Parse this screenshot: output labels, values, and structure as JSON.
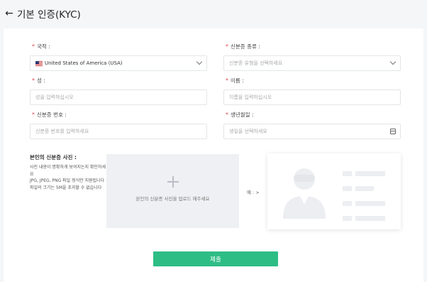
{
  "header": {
    "back_icon": "arrow-left-icon",
    "title": "기본 인증(KYC)"
  },
  "form": {
    "nationality": {
      "label": "국적 :",
      "value": "United States of America (USA)",
      "flag_icon": "us-flag-icon"
    },
    "id_type": {
      "label": "신분증 종류 :",
      "placeholder": "신분증 유형을 선택하세요"
    },
    "last_name": {
      "label": "성 :",
      "placeholder": "성을 입력하십시오"
    },
    "first_name": {
      "label": "이름 :",
      "placeholder": "이름을 입력하십시오"
    },
    "id_number": {
      "label": "신분증 번호 :",
      "placeholder": "신분증 번호를 입력하세요"
    },
    "birthdate": {
      "label": "생년월일 :",
      "placeholder": "생일을 선택하세요"
    },
    "required_mark": "*"
  },
  "photo": {
    "title": "본인의 신분증 사진 :",
    "desc_lines": [
      "사진 내용이 명확하게 보여지는지 확인하세요",
      "JPG, JPEG, PNG 파일 형식만 지원됩니다",
      "파일의 크기는 5M을 초과할 수 없습니다"
    ],
    "upload_text": "본인의 신분증 사진을 업로드 해주세요",
    "example_label": "예 : >",
    "upload_icon": "plus-icon",
    "example_icon": "id-card-illustration"
  },
  "submit_label": "제출",
  "colors": {
    "accent": "#2ebd85",
    "required": "#e5484d",
    "upload_bg": "#eef0f3"
  }
}
